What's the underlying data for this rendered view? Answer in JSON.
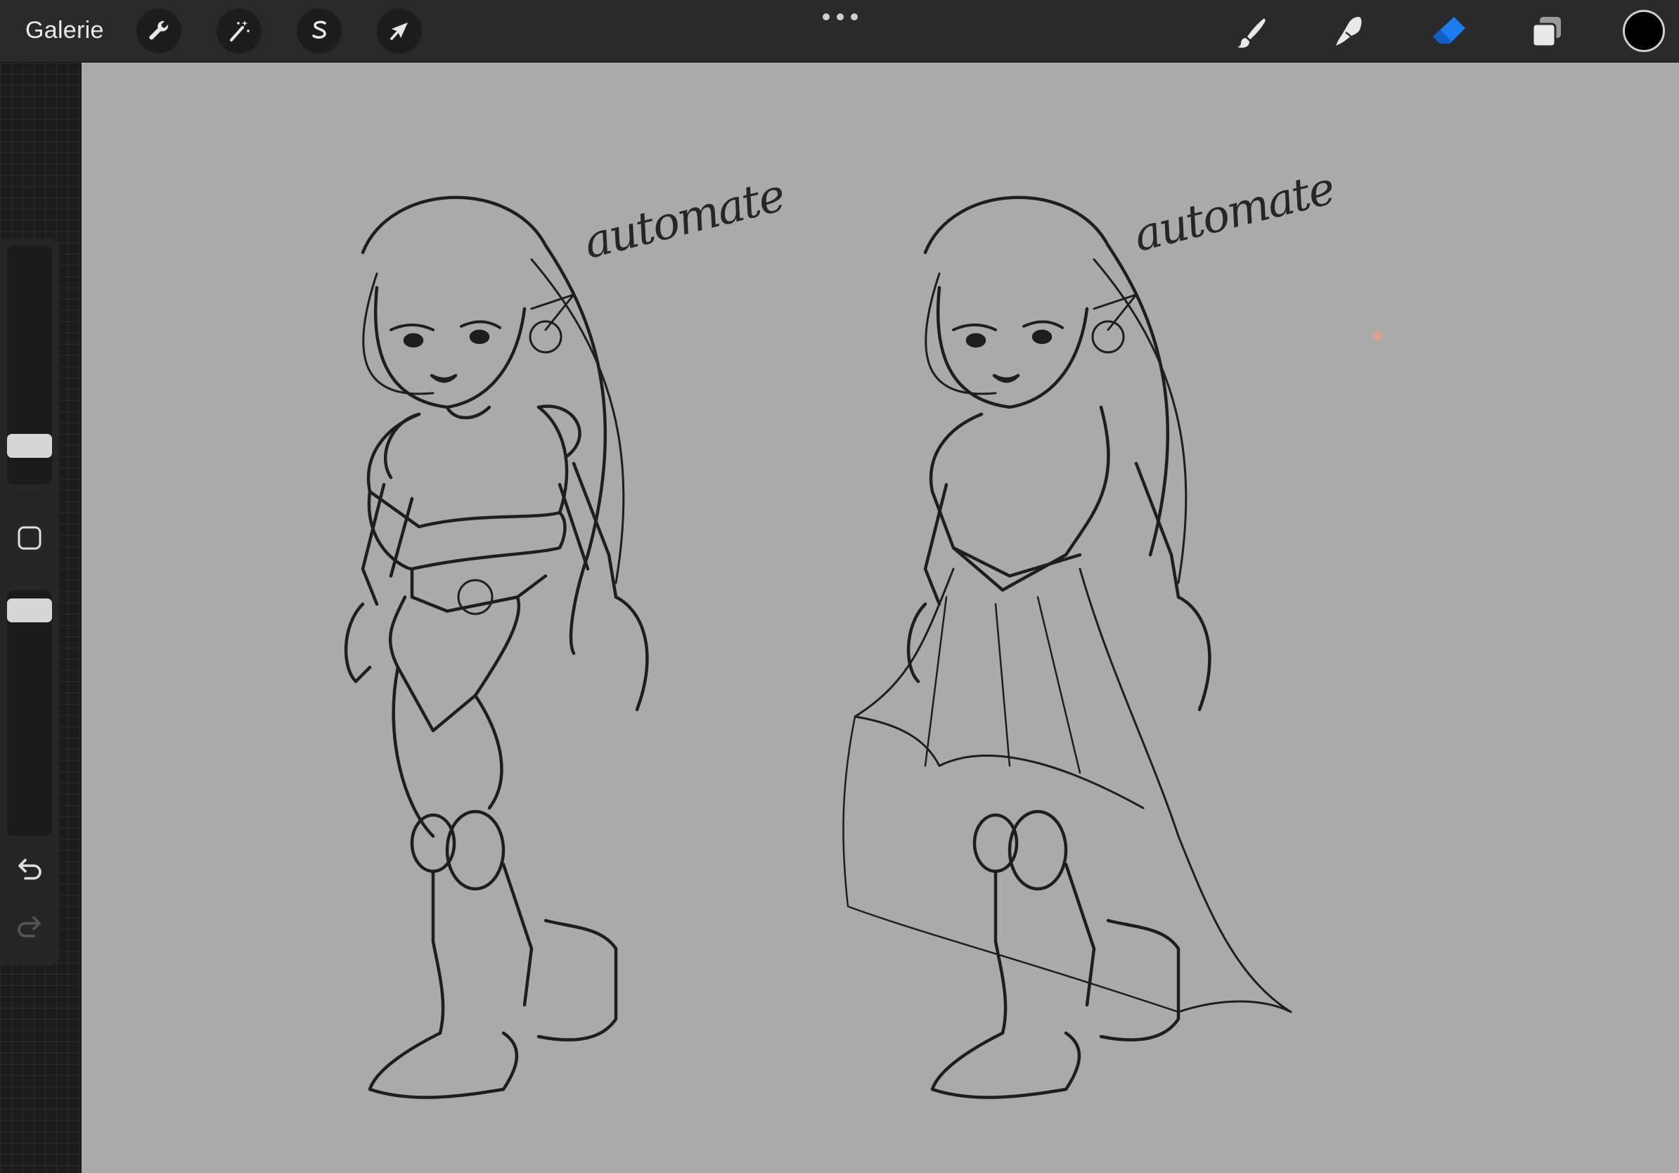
{
  "topbar": {
    "gallery_label": "Galerie",
    "left_tools": [
      {
        "name": "actions",
        "icon": "wrench-icon"
      },
      {
        "name": "adjustments",
        "icon": "magic-wand-icon"
      },
      {
        "name": "selection",
        "icon": "selection-s-icon"
      },
      {
        "name": "transform",
        "icon": "arrow-cursor-icon"
      }
    ],
    "right_tools": [
      {
        "name": "brush",
        "icon": "brush-icon",
        "active": false
      },
      {
        "name": "smudge",
        "icon": "smudge-finger-icon",
        "active": false
      },
      {
        "name": "eraser",
        "icon": "eraser-icon",
        "active": true
      },
      {
        "name": "layers",
        "icon": "layers-icon",
        "active": false
      }
    ],
    "active_color": "#000000",
    "accent_color": "#1a7cf0"
  },
  "sidebar": {
    "brush_size_level": 0.16,
    "opacity_level": 0.0,
    "modify_icon": "square-icon",
    "undo_icon": "undo-icon",
    "redo_icon": "redo-icon"
  },
  "canvas": {
    "background": "#aaaaaa",
    "left_sketch_label": "automate",
    "right_sketch_label": "automate"
  }
}
